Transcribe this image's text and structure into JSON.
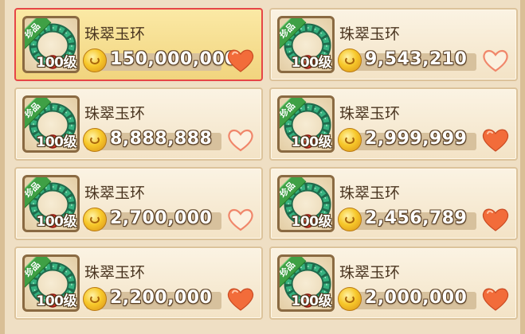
{
  "item_badge": "珍品",
  "items": [
    {
      "name": "珠翠玉环",
      "level": "100级",
      "price": "150,000,000",
      "favorited": true,
      "selected": true
    },
    {
      "name": "珠翠玉环",
      "level": "100级",
      "price": "9,543,210",
      "favorited": false,
      "selected": false
    },
    {
      "name": "珠翠玉环",
      "level": "100级",
      "price": "8,888,888",
      "favorited": false,
      "selected": false
    },
    {
      "name": "珠翠玉环",
      "level": "100级",
      "price": "2,999,999",
      "favorited": true,
      "selected": false
    },
    {
      "name": "珠翠玉环",
      "level": "100级",
      "price": "2,700,000",
      "favorited": false,
      "selected": false
    },
    {
      "name": "珠翠玉环",
      "level": "100级",
      "price": "2,456,789",
      "favorited": true,
      "selected": false
    },
    {
      "name": "珠翠玉环",
      "level": "100级",
      "price": "2,200,000",
      "favorited": true,
      "selected": false
    },
    {
      "name": "珠翠玉环",
      "level": "100级",
      "price": "2,000,000",
      "favorited": true,
      "selected": false
    }
  ],
  "colors": {
    "heart_filled": "#f26c3a",
    "heart_empty_stroke": "#f0866a",
    "selected_border": "#e64646",
    "bracelet_jade": "#2f9e6e",
    "bracelet_gem": "#e2352b"
  }
}
